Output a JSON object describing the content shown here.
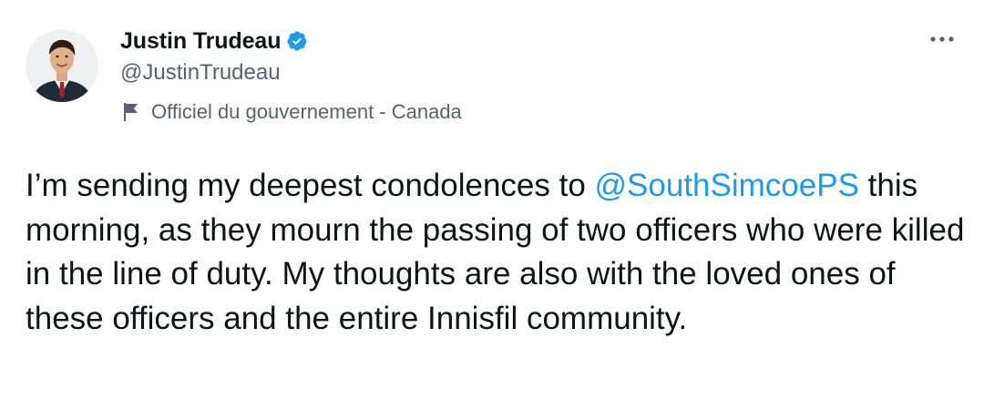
{
  "author": {
    "display_name": "Justin Trudeau",
    "handle": "@JustinTrudeau",
    "verified_icon": "verified-badge-icon",
    "label": "Officiel du gouvernement - Canada",
    "label_icon": "flag-icon"
  },
  "more_icon": "more-options-icon",
  "tweet": {
    "text_before_mention": "I’m sending my deepest condolences to ",
    "mention": "@SouthSimcoePS",
    "text_after_mention": " this morning, as they mourn the passing of two officers who were killed in the line of duty. My thoughts are also with the loved ones of these officers and the entire Innisfil community."
  },
  "colors": {
    "text": "#0f1419",
    "secondary": "#536471",
    "link": "#1d9bf0",
    "verified": "#1d9bf0"
  }
}
